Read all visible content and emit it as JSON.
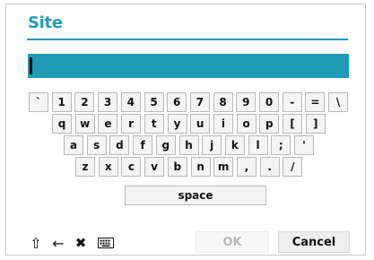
{
  "dialog": {
    "title": "Site"
  },
  "input": {
    "value": ""
  },
  "keyboard": {
    "rows": [
      [
        "`",
        "1",
        "2",
        "3",
        "4",
        "5",
        "6",
        "7",
        "8",
        "9",
        "0",
        "-",
        "=",
        "\\"
      ],
      [
        "q",
        "w",
        "e",
        "r",
        "t",
        "y",
        "u",
        "i",
        "o",
        "p",
        "[",
        "]"
      ],
      [
        "a",
        "s",
        "d",
        "f",
        "g",
        "h",
        "j",
        "k",
        "l",
        ";",
        "'"
      ],
      [
        "z",
        "x",
        "c",
        "v",
        "b",
        "n",
        "m",
        ",",
        ".",
        "/"
      ],
      [
        "space"
      ]
    ]
  },
  "toolbar": {
    "shift_icon": "⇧",
    "backspace_icon": "←",
    "clear_icon": "✖"
  },
  "buttons": {
    "ok": "OK",
    "cancel": "Cancel"
  },
  "colors": {
    "accent": "#1f9bb5",
    "ok_disabled_text": "#b9b9b9"
  }
}
